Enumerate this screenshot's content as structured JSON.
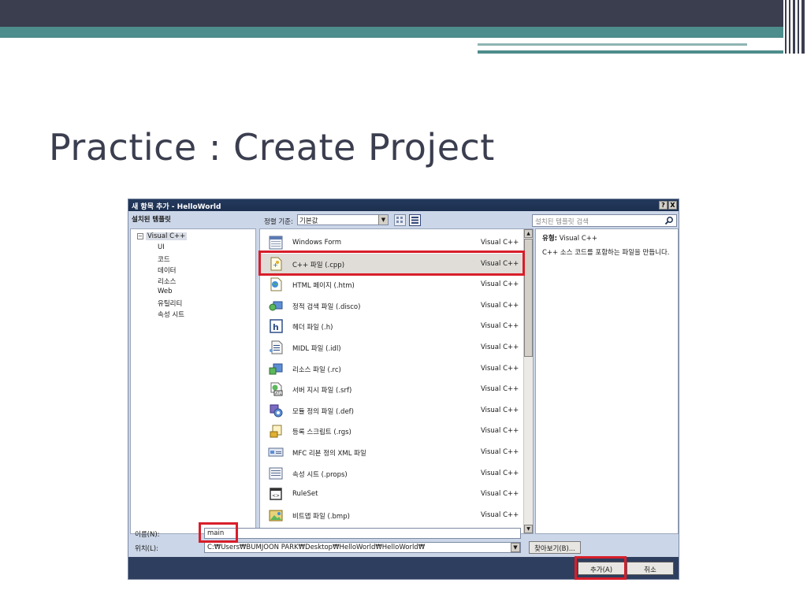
{
  "slide": {
    "title": "Practice : Create Project",
    "colors": {
      "dark": "#3b3e4f",
      "teal": "#4d8d8b",
      "highlight": "#d81e2a"
    }
  },
  "dialog": {
    "title": "새 항목 추가 - HelloWorld",
    "title_buttons": {
      "help": "?",
      "close": "X"
    },
    "left_header": "설치된 템플릿",
    "tree": {
      "root": "Visual C++",
      "children": [
        "UI",
        "코드",
        "데이터",
        "리소스",
        "Web",
        "유틸리티",
        "속성 시트"
      ]
    },
    "sort_label": "정렬 기준:",
    "sort_value": "기본값",
    "search_placeholder": "설치된 템플릿 검색",
    "templates": [
      {
        "name": "Windows Form",
        "lang": "Visual C++",
        "icon": "windows-form-icon"
      },
      {
        "name": "C++ 파일 (.cpp)",
        "lang": "Visual C++",
        "icon": "cpp-file-icon",
        "selected": true
      },
      {
        "name": "HTML 페이지 (.htm)",
        "lang": "Visual C++",
        "icon": "html-page-icon"
      },
      {
        "name": "정적 검색 파일 (.disco)",
        "lang": "Visual C++",
        "icon": "disco-file-icon"
      },
      {
        "name": "헤더 파일 (.h)",
        "lang": "Visual C++",
        "icon": "header-file-icon"
      },
      {
        "name": "MIDL 파일 (.idl)",
        "lang": "Visual C++",
        "icon": "midl-file-icon"
      },
      {
        "name": "리소스 파일 (.rc)",
        "lang": "Visual C++",
        "icon": "resource-file-icon"
      },
      {
        "name": "서버 지시 파일 (.srf)",
        "lang": "Visual C++",
        "icon": "srf-file-icon"
      },
      {
        "name": "모듈 정의 파일 (.def)",
        "lang": "Visual C++",
        "icon": "def-file-icon"
      },
      {
        "name": "등록 스크립트 (.rgs)",
        "lang": "Visual C++",
        "icon": "rgs-file-icon"
      },
      {
        "name": "MFC 리본 정의 XML 파일",
        "lang": "Visual C++",
        "icon": "ribbon-xml-icon"
      },
      {
        "name": "속성 시트 (.props)",
        "lang": "Visual C++",
        "icon": "props-file-icon"
      },
      {
        "name": "RuleSet",
        "lang": "Visual C++",
        "icon": "ruleset-icon"
      },
      {
        "name": "비트맵 파일 (.bmp)",
        "lang": "Visual C++",
        "icon": "bitmap-file-icon"
      }
    ],
    "description": {
      "type_label": "유형:",
      "type_value": "Visual C++",
      "text": "C++ 소스 코드를 포함하는 파일을 만듭니다."
    },
    "name_label": "이름(N):",
    "name_value": "main",
    "location_label": "위치(L):",
    "location_value": "C:₩Users₩BUMJOON PARK₩Desktop₩HelloWorld₩HelloWorld₩",
    "browse_label": "찾아보기(B)...",
    "add_label": "추가(A)",
    "cancel_label": "취소"
  }
}
